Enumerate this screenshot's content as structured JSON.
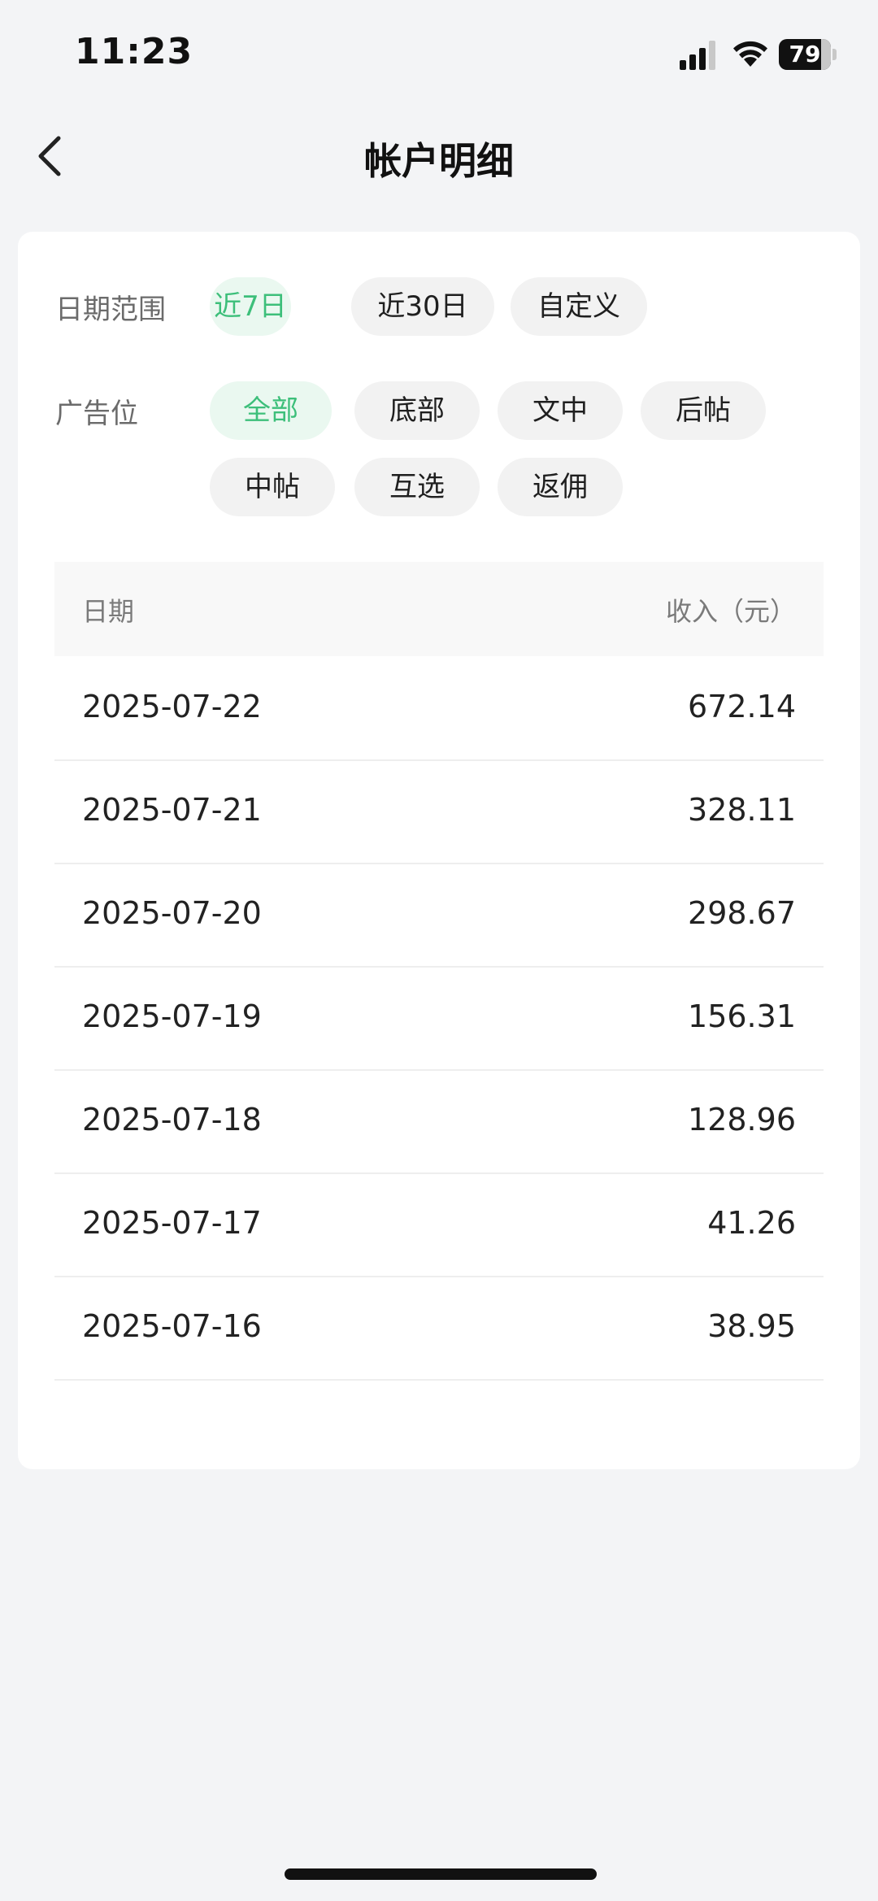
{
  "status_bar": {
    "time": "11:23",
    "battery": "79"
  },
  "nav": {
    "title": "帐户明细"
  },
  "filters": {
    "date_range": {
      "label": "日期范围",
      "options": [
        "近7日",
        "近30日",
        "自定义"
      ],
      "selected": "近7日"
    },
    "ad_slot": {
      "label": "广告位",
      "options": [
        "全部",
        "底部",
        "文中",
        "后帖",
        "中帖",
        "互选",
        "返佣"
      ],
      "selected": "全部"
    }
  },
  "table": {
    "headers": {
      "date": "日期",
      "income": "收入（元）"
    },
    "rows": [
      {
        "date": "2025-07-22",
        "income": "672.14"
      },
      {
        "date": "2025-07-21",
        "income": "328.11"
      },
      {
        "date": "2025-07-20",
        "income": "298.67"
      },
      {
        "date": "2025-07-19",
        "income": "156.31"
      },
      {
        "date": "2025-07-18",
        "income": "128.96"
      },
      {
        "date": "2025-07-17",
        "income": "41.26"
      },
      {
        "date": "2025-07-16",
        "income": "38.95"
      }
    ]
  },
  "colors": {
    "accent": "#3dbf7a",
    "accent_bg": "#eaf8f0",
    "page_bg": "#f3f4f6"
  }
}
